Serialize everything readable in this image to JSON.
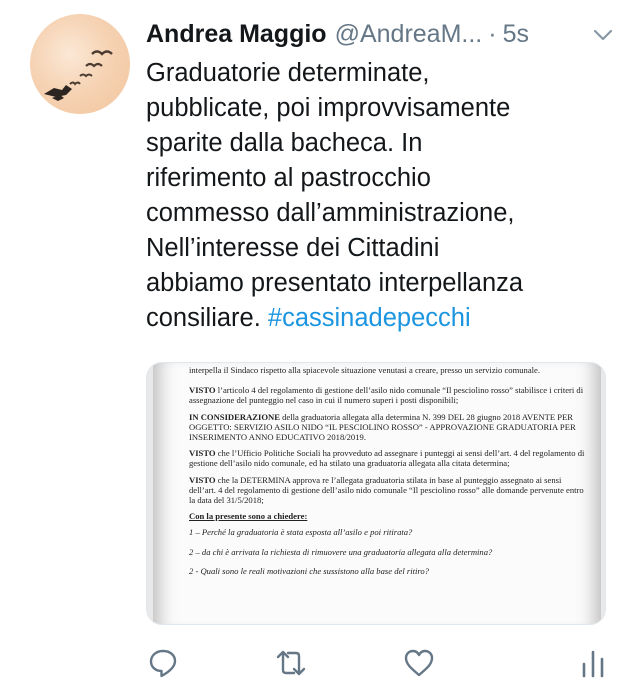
{
  "tweet": {
    "author_name": "Andrea Maggio",
    "handle": "@AndreaM...",
    "separator": "·",
    "time": "5s",
    "text_lines": [
      "Graduatorie determinate,",
      "pubblicate, poi improvvisamente",
      "sparite dalla bacheca. In",
      "riferimento al pastrocchio",
      "commesso dall’amministrazione,",
      "Nell’interesse dei Cittadini",
      "abbiamo presentato interpellanza",
      "consiliare."
    ],
    "hashtag": "#cassinadepecchi"
  },
  "document": {
    "intro": "interpella il Sindaco rispetto alla spiacevole situazione venutasi a creare, presso un servizio comunale.",
    "visto1_label": "VISTO",
    "visto1_text": " l’articolo 4 del regolamento di gestione dell’asilo nido comunale “Il pesciolino rosso” stabilisce i criteri di assegnazione del punteggio nel caso in cui il numero superi i posti disponibili;",
    "consid_label": "IN CONSIDERAZIONE",
    "consid_text": " della graduatoria allegata alla determina N. 399 DEL 28 giugno 2018 AVENTE PER OGGETTO: SERVIZIO ASILO NIDO “IL PESCIOLINO ROSSO” - APPROVAZIONE GRADUATORIA PER INSERIMENTO ANNO EDUCATIVO 2018/2019.",
    "visto2_label": "VISTO",
    "visto2_text": " che l’Ufficio Politiche Sociali ha provveduto ad assegnare i punteggi ai sensi dell’art. 4 del regolamento di gestione dell’asilo nido comunale, ed ha stilato una graduatoria allegata alla citata determina;",
    "visto3_label": "VISTO",
    "visto3_text": " che la DETERMINA approva re l’allegata graduatoria stilata in base al punteggio assegnato ai sensi dell’art. 4 del regolamento di gestione dell’asilo nido comunale “Il pesciolino rosso” alle domande pervenute entro la data del 31/5/2018;",
    "heading": "Con la presente sono a chiedere:",
    "q1": "1 – Perché la graduatoria è stata esposta all’asilo e poi ritirata?",
    "q2": "2 – da chi è arrivata la richiesta di rimuovere una graduatoria allegata alla determina?",
    "q3": "2 - Quali sono le reali motivazioni che sussistono alla base del ritiro?"
  },
  "icons": {
    "reply": "reply-icon",
    "retweet": "retweet-icon",
    "like": "heart-icon",
    "analytics": "analytics-icon",
    "more": "chevron-down-icon"
  },
  "colors": {
    "text": "#14171a",
    "secondary": "#657786",
    "link": "#1b95e0",
    "icon": "#657786"
  }
}
